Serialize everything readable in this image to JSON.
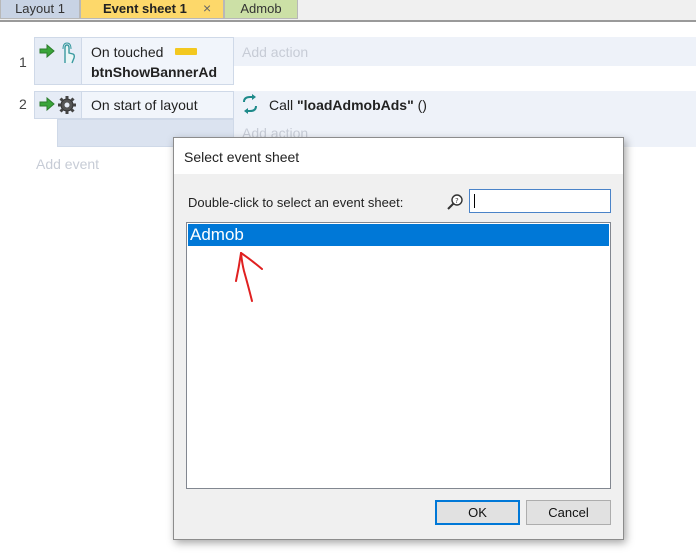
{
  "tabs": [
    {
      "label": "Layout 1"
    },
    {
      "label": "Event sheet 1",
      "close_icon": "×"
    },
    {
      "label": "Admob"
    }
  ],
  "events": [
    {
      "number": "1",
      "condition": "On touched",
      "object": "btnShowBannerAd",
      "add_action": "Add action"
    },
    {
      "number": "2",
      "condition": "On start of layout",
      "action_prefix": "Call ",
      "action_function": "\"loadAdmobAds\"",
      "action_suffix": " ()",
      "add_action": "Add action"
    }
  ],
  "add_event": "Add event",
  "dialog": {
    "title": "Select event sheet",
    "prompt": "Double-click to select an event sheet:",
    "search_value": "",
    "items": [
      "Admob"
    ],
    "ok_label": "OK",
    "cancel_label": "Cancel"
  },
  "colors": {
    "selection": "#0078d7",
    "tab_active": "#fdd86a",
    "annotation": "#e02020"
  },
  "icons": {
    "condition_arrow": "green-arrow-icon",
    "touch": "touch-icon",
    "system": "gear-icon",
    "function": "function-call-icon",
    "search": "search-icon"
  }
}
